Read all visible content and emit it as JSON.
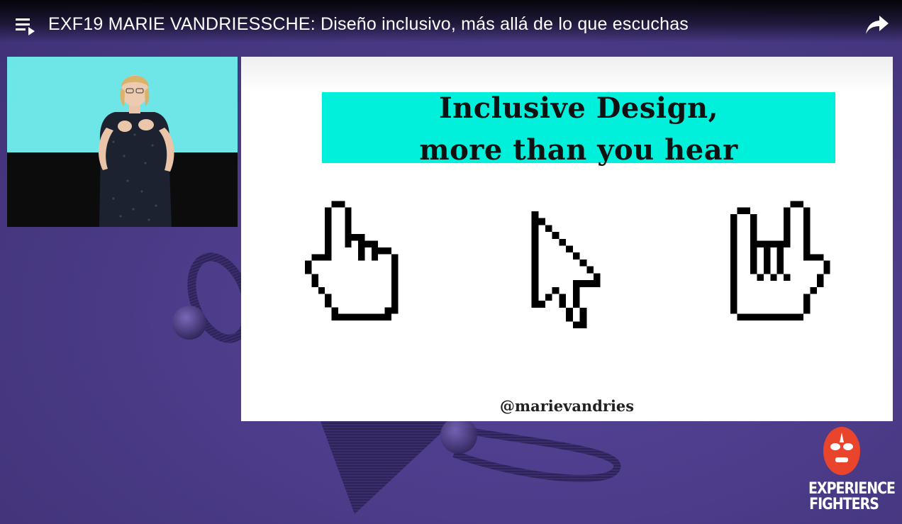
{
  "player": {
    "title": "EXF19 MARIE VANDRIESSCHE: Diseño inclusivo, más allá de lo que escuchas",
    "icons": {
      "playlist": "playlist-icon",
      "share": "share-icon"
    }
  },
  "slide": {
    "title_line1": "Inclusive Design,",
    "title_line2": "more than you hear",
    "handle": "@marievandries",
    "accent_color": "#00f0dc",
    "cursors": [
      "pointing-hand-cursor-icon",
      "arrow-cursor-icon",
      "rock-hand-cursor-icon"
    ]
  },
  "logo": {
    "line1": "EXPERIENCE",
    "line2": "FIGHTERS",
    "mask_color": "#e8452c"
  },
  "colors": {
    "background": "#4a3a86",
    "slide_bg": "#ffffff"
  }
}
